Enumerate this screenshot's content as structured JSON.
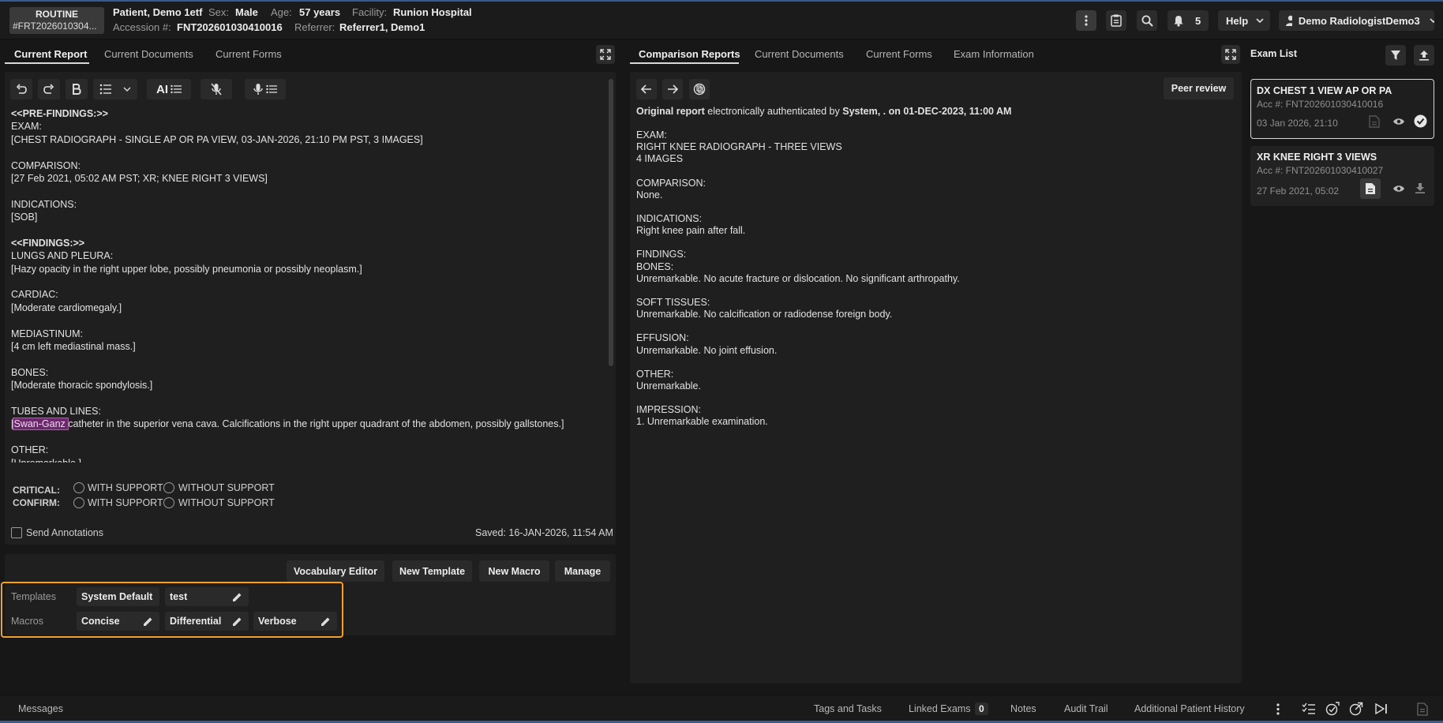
{
  "header": {
    "priority": "ROUTINE",
    "order_id": "#FRT2026010304...",
    "patient_name": "Patient, Demo 1etf",
    "sex_label": "Sex:",
    "sex": "Male",
    "age_label": "Age:",
    "age": "57 years",
    "facility_label": "Facility:",
    "facility": "Runion Hospital",
    "accession_label": "Accession #:",
    "accession": "FNT202601030410016",
    "referrer_label": "Referrer:",
    "referrer": "Referrer1, Demo1",
    "notification_count": "5",
    "help_label": "Help",
    "user_name": "Demo RadiologistDemo3"
  },
  "left_tabs": [
    "Current Report",
    "Current Documents",
    "Current Forms"
  ],
  "right_tabs": [
    "Comparison Reports",
    "Current Documents",
    "Current Forms",
    "Exam Information"
  ],
  "editor": {
    "ai_label": "AI",
    "lines": [
      {
        "text": "<<PRE-FINDINGS:>>",
        "bold": true
      },
      {
        "text": "EXAM:"
      },
      {
        "text": "[CHEST RADIOGRAPH - SINGLE AP OR PA VIEW, 03-JAN-2026, 21:10 PM PST, 3 IMAGES]"
      },
      {
        "text": ""
      },
      {
        "text": "COMPARISON:"
      },
      {
        "text": "[27 Feb 2021, 05:02 AM PST; XR; KNEE RIGHT 3 VIEWS]"
      },
      {
        "text": ""
      },
      {
        "text": "INDICATIONS:"
      },
      {
        "text": "[SOB]"
      },
      {
        "text": ""
      },
      {
        "text": "<<FINDINGS:>>",
        "bold": true
      },
      {
        "text": "LUNGS AND PLEURA:"
      },
      {
        "text": "[Hazy opacity in the right upper lobe, possibly pneumonia or possibly neoplasm.]"
      },
      {
        "text": ""
      },
      {
        "text": "CARDIAC:"
      },
      {
        "text": "[Moderate cardiomegaly.]"
      },
      {
        "text": ""
      },
      {
        "text": "MEDIASTINUM:"
      },
      {
        "text": "[4 cm left mediastinal mass.]"
      },
      {
        "text": ""
      },
      {
        "text": "BONES:"
      },
      {
        "text": "[Moderate thoracic spondylosis.]"
      },
      {
        "text": ""
      },
      {
        "text": "TUBES AND LINES:"
      },
      {
        "text": "[",
        "highlight": "Swan-Ganz ",
        "after": "catheter in the superior vena cava. Calcifications in the right upper quadrant of the abdomen, possibly gallstones.]"
      },
      {
        "text": ""
      },
      {
        "text": "OTHER:"
      },
      {
        "text": "[Unremarkable.]"
      }
    ],
    "critical_label": "CRITICAL:",
    "confirm_label": "CONFIRM:",
    "with_support": "WITH SUPPORT",
    "without_support": "WITHOUT SUPPORT",
    "send_annotations": "Send Annotations",
    "saved": "Saved: 16-JAN-2026, 11:54 AM"
  },
  "actions": {
    "vocabulary_editor": "Vocabulary Editor",
    "new_template": "New Template",
    "new_macro": "New Macro",
    "manage": "Manage"
  },
  "templates": {
    "label": "Templates",
    "items": [
      "System Default",
      "test"
    ]
  },
  "macros": {
    "label": "Macros",
    "items": [
      "Concise",
      "Differential",
      "Verbose"
    ]
  },
  "comparison": {
    "peer_review": "Peer review",
    "auth_prefix": "Original report",
    "auth_mid": " electronically authenticated by ",
    "auth_by": "System, . on 01-DEC-2023, 11:00 AM",
    "lines": [
      "EXAM:",
      "RIGHT KNEE RADIOGRAPH - THREE VIEWS",
      "4 IMAGES",
      "",
      "COMPARISON:",
      "None.",
      "",
      "INDICATIONS:",
      "Right knee pain after fall.",
      "",
      "FINDINGS:",
      "BONES:",
      "Unremarkable. No acute fracture or dislocation. No significant arthropathy.",
      "",
      "SOFT TISSUES:",
      "Unremarkable. No calcification or radiodense foreign body.",
      "",
      "EFFUSION:",
      "Unremarkable. No joint effusion.",
      "",
      "OTHER:",
      "Unremarkable.",
      "",
      "IMPRESSION:",
      "1. Unremarkable examination."
    ]
  },
  "exam_list": {
    "title": "Exam List",
    "items": [
      {
        "title": "DX CHEST 1 VIEW AP OR PA",
        "acc": "Acc #: FNT202601030410016",
        "date": "03 Jan 2026, 21:10"
      },
      {
        "title": "XR KNEE RIGHT 3 VIEWS",
        "acc": "Acc #: FNT202601030410027",
        "date": "27 Feb 2021, 05:02"
      }
    ]
  },
  "statusbar": {
    "messages": "Messages",
    "tags_tasks": "Tags and Tasks",
    "linked_exams": "Linked Exams",
    "linked_count": "0",
    "notes": "Notes",
    "audit_trail": "Audit Trail",
    "additional_history": "Additional Patient History"
  },
  "colors": {
    "accent_orange": "#f0a030",
    "highlight": "#6a2a6a"
  }
}
